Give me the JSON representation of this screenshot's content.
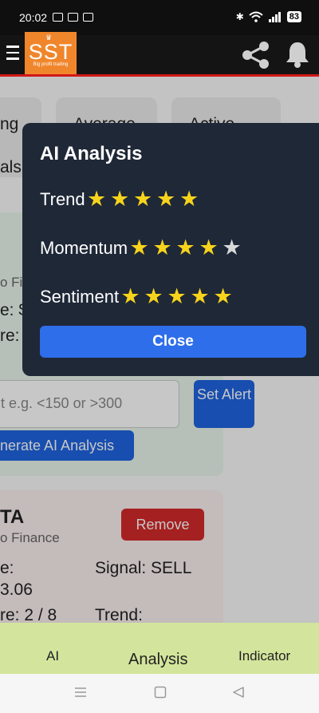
{
  "status_bar": {
    "time": "20:02",
    "battery": "83"
  },
  "header": {
    "logo_text": "SST",
    "logo_tagline": "Big profit trading",
    "icons": [
      "menu-icon",
      "share-icon",
      "bell-icon"
    ]
  },
  "background": {
    "stat_cards": [
      "ng",
      "Average",
      "Active",
      "als"
    ],
    "stock1": {
      "source": "o Finance",
      "price_label": "e: $",
      "score_label": "re: 9",
      "alert_placeholder": "t e.g. <150 or >300",
      "set_alert_label": "Set Alert",
      "generate_label": "nerate AI Analysis"
    },
    "stock2": {
      "symbol": "TA",
      "source": "o Finance",
      "remove_label": "Remove",
      "price_label": "e:",
      "price_value": "3.06",
      "score_label": "re: 2 / 8",
      "signal": "Signal: SELL",
      "trend": "Trend:"
    }
  },
  "modal": {
    "title": "AI Analysis",
    "ratings": [
      {
        "label": "Trend",
        "rating": 5,
        "max": 5
      },
      {
        "label": "Momentum",
        "rating": 4,
        "max": 5
      },
      {
        "label": "Sentiment",
        "rating": 5,
        "max": 5
      }
    ],
    "close_label": "Close",
    "colors": {
      "background": "#1f2837",
      "star_on": "#f7d31c",
      "star_off": "#d9d9d9",
      "button": "#2f6eea"
    }
  },
  "bottom_nav": {
    "items": [
      {
        "label": "AI"
      },
      {
        "label": "Analysis",
        "active": true
      },
      {
        "label": "Indicator"
      }
    ]
  },
  "system_nav": {
    "icons": [
      "recents-icon",
      "home-icon",
      "back-icon"
    ]
  }
}
